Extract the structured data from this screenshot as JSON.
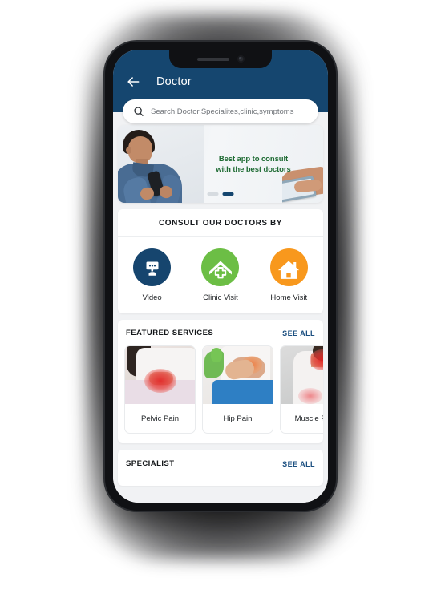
{
  "device": {
    "frame": "smartphone-mockup",
    "notch_speaker": "speaker-grille",
    "notch_camera": "front-camera"
  },
  "header": {
    "title": "Doctor",
    "back_icon": "arrow-left-icon",
    "background_color": "#15466f"
  },
  "search": {
    "placeholder": "Search Doctor,Specialites,clinic,symptoms",
    "value": "",
    "icon": "search-icon"
  },
  "banner": {
    "line1": "Best app to consult",
    "line2": "with the best doctors",
    "text_color": "#1e6b33",
    "dots": [
      {
        "active": false
      },
      {
        "active": true
      }
    ]
  },
  "consult": {
    "title": "CONSULT OUR DOCTORS BY",
    "options": [
      {
        "label": "Video",
        "icon": "video-chat-bubble-icon",
        "color": "#16456e"
      },
      {
        "label": "Clinic Visit",
        "icon": "clinic-cross-house-icon",
        "color": "#6cbe45"
      },
      {
        "label": "Home Visit",
        "icon": "home-house-icon",
        "color": "#f8981d"
      }
    ]
  },
  "featured_services": {
    "title": "FEATURED SERVICES",
    "see_all": "SEE ALL",
    "items": [
      {
        "name": "Pelvic Pain",
        "image": "pelvic-pain-photo"
      },
      {
        "name": "Hip Pain",
        "image": "hip-pain-photo"
      },
      {
        "name": "Muscle Pain",
        "image": "muscle-pain-photo"
      }
    ]
  },
  "specialist": {
    "title": "SPECIALIST",
    "see_all": "SEE ALL"
  },
  "colors": {
    "primary": "#15466f",
    "link": "#1b4f80",
    "green": "#6cbe45",
    "orange": "#f8981d",
    "page_bg": "#f1f2f4"
  }
}
